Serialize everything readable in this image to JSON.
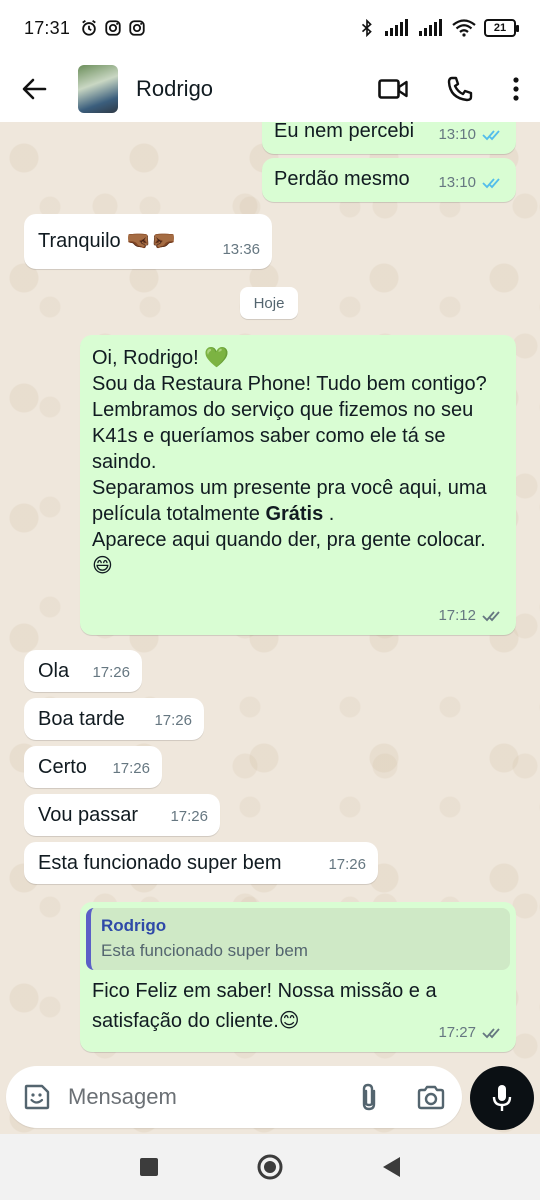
{
  "status_bar": {
    "time": "17:31",
    "battery": "21"
  },
  "header": {
    "contact_name": "Rodrigo"
  },
  "date_divider": "Hoje",
  "messages": [
    {
      "text": "Eu nem percebi",
      "time": "13:10"
    },
    {
      "text": "Perdão mesmo",
      "time": "13:10"
    },
    {
      "text": "Tranquilo 🤜🏾🤛🏾",
      "time": "13:36"
    },
    {
      "line1": "Oi, Rodrigo! 💚",
      "line2": "Sou da Restaura Phone! Tudo bem contigo?",
      "line3": "Lembramos do serviço que fizemos no seu K41s e queríamos saber como ele tá se saindo.",
      "line4_pre": "Separamos um presente pra você aqui, uma película totalmente ",
      "line4_bold": "Grátis",
      "line4_post": " .",
      "line5": "Aparece aqui quando der, pra gente colocar. 😄",
      "time": "17:12"
    },
    {
      "text": "Ola",
      "time": "17:26"
    },
    {
      "text": "Boa tarde",
      "time": "17:26"
    },
    {
      "text": "Certo",
      "time": "17:26"
    },
    {
      "text": "Vou passar",
      "time": "17:26"
    },
    {
      "text": "Esta funcionado super bem",
      "time": "17:26"
    },
    {
      "quote_author": "Rodrigo",
      "quote_text": "Esta funcionado super bem",
      "text": "Fico Feliz em saber! Nossa missão e a satisfação do cliente.😊",
      "time": "17:27"
    }
  ],
  "input": {
    "placeholder": "Mensagem"
  },
  "colors": {
    "incoming": "#ffffff",
    "outgoing": "#d9fdd3",
    "read_ticks": "#53bdeb",
    "delivered_ticks": "#667781",
    "wallpaper": "#efe7dc"
  }
}
